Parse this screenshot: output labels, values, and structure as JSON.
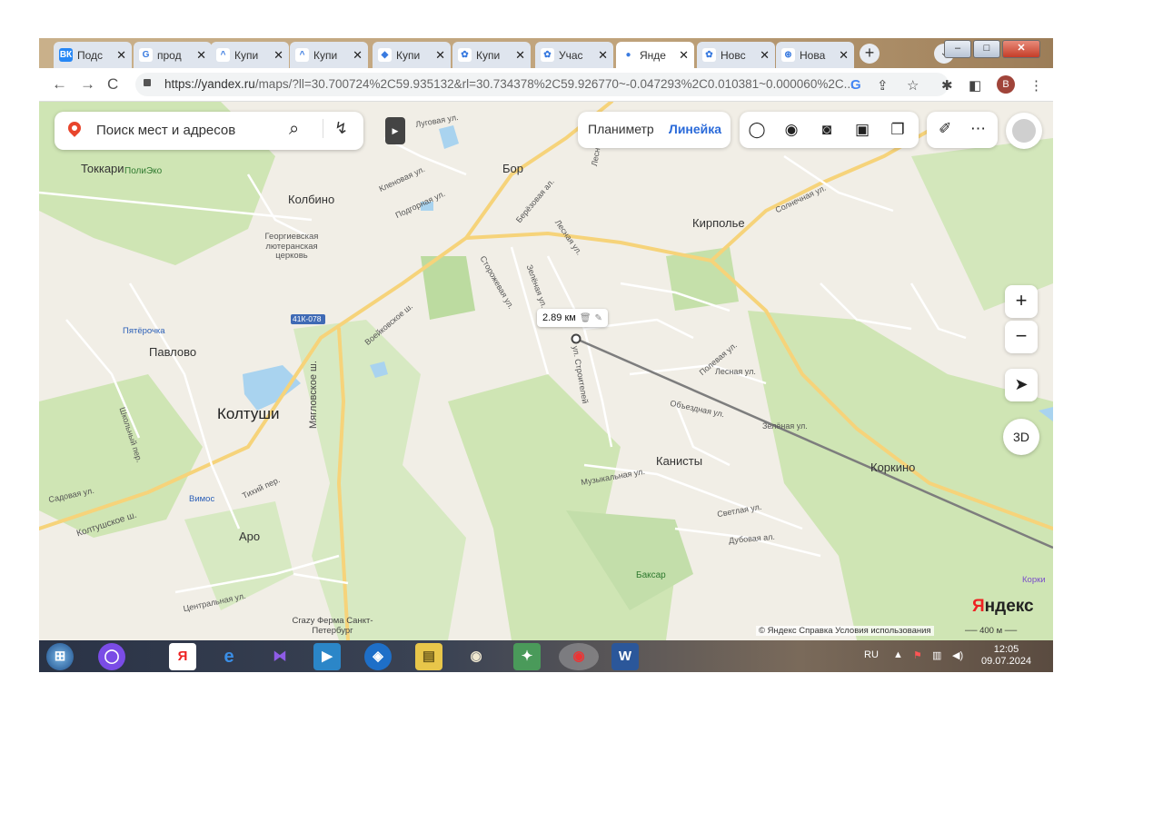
{
  "browser": {
    "tabs": [
      {
        "label": "Подс",
        "icon": "vk-icon",
        "color": "#2787f5",
        "glyph": "ВК"
      },
      {
        "label": "прод",
        "icon": "google-icon",
        "color": "#ffffff",
        "glyph": "G"
      },
      {
        "label": "Купи",
        "icon": "avito-icon",
        "color": "#ffffff",
        "glyph": "^"
      },
      {
        "label": "Купи",
        "icon": "avito-icon",
        "color": "#ffffff",
        "glyph": "^"
      },
      {
        "label": "Купи",
        "icon": "domclick-icon",
        "color": "#ffffff",
        "glyph": "◆"
      },
      {
        "label": "Купи",
        "icon": "cian-icon",
        "color": "#ffffff",
        "glyph": "✿"
      },
      {
        "label": "Учас",
        "icon": "cian-icon",
        "color": "#ffffff",
        "glyph": "✿"
      },
      {
        "label": "Янде",
        "icon": "yandex-maps-icon",
        "color": "#ffffff",
        "glyph": "●",
        "active": true
      },
      {
        "label": "Новс",
        "icon": "cian-icon",
        "color": "#ffffff",
        "glyph": "✿"
      },
      {
        "label": "Нова",
        "icon": "chatgpt-icon",
        "color": "#ffffff",
        "glyph": "⊛"
      }
    ],
    "close_glyph": "✕",
    "url_main": "https://yandex.ru",
    "url_rest": "/maps/?ll=30.700724%2C59.935132&rl=30.734378%2C59.926770~-0.047293%2C0.010381~0.000060%2C...",
    "profile_letter": "B"
  },
  "map": {
    "search_placeholder": "Поиск мест и адресов",
    "toolbar": {
      "planimeter": "Планиметр",
      "ruler": "Линейка"
    },
    "zoom_in": "+",
    "zoom_out": "−",
    "btn_3d": "3D",
    "distance": {
      "value": "2.89 км"
    },
    "labels": {
      "toccari": "Токкари",
      "polieco": "ПолиЭко",
      "kolbino": "Колбино",
      "church": "Георгиевская лютеранская церковь",
      "bor": "Бор",
      "kirpolye": "Кирполье",
      "pyaterochka": "Пятёрочка",
      "pavlovo": "Павлово",
      "koltushi": "Колтуши",
      "kanisty": "Канисты",
      "korkino": "Коркино",
      "vimos": "Вимос",
      "aro": "Аро",
      "baksar": "Баксар",
      "crazy": "Crazy Ферма Санкт-Петербург",
      "road_41k": "41К-078",
      "myaglovskoe": "Мягловское ш.",
      "voeikovskoe": "Воейковское ш.",
      "koltushskoe": "Колтушское ш.",
      "sadovaya": "Садовая ул.",
      "tikhiy": "Тихий пер.",
      "tsentralnaya": "Центральная ул.",
      "shkolny": "Школьный пер.",
      "muzykalnaya": "Музыкальная ул.",
      "obezdnaya": "Объездная ул.",
      "lesnaya": "Лесная ул.",
      "zelenaya": "Зелёная ул.",
      "polevaya": "Полевая ул.",
      "svetlaya": "Светлая ул.",
      "dubovaya": "Дубовая ал.",
      "stroiteley": "ул. Строителей",
      "solnechnaya": "Солнечная ул.",
      "lugovaya": "Луговая ул.",
      "klenovaya": "Кленовая ул.",
      "podgornaya": "Подгорная ул.",
      "berezovaya": "Берёзовая ал.",
      "storozhevaya": "Сторожевая ул.",
      "zelenaya2": "Зелёная ул.",
      "lesnaya2": "Лесная ул.",
      "lesnaya3": "Лесная ул.",
      "korkino_poi": "Корки"
    },
    "logo_ya": "Я",
    "logo_rest": "ндекс",
    "copyright": "© Яндекс  Справка  Условия использования",
    "scale": "400 м"
  },
  "taskbar": {
    "lang": "RU",
    "time": "12:05",
    "date": "09.07.2024"
  }
}
